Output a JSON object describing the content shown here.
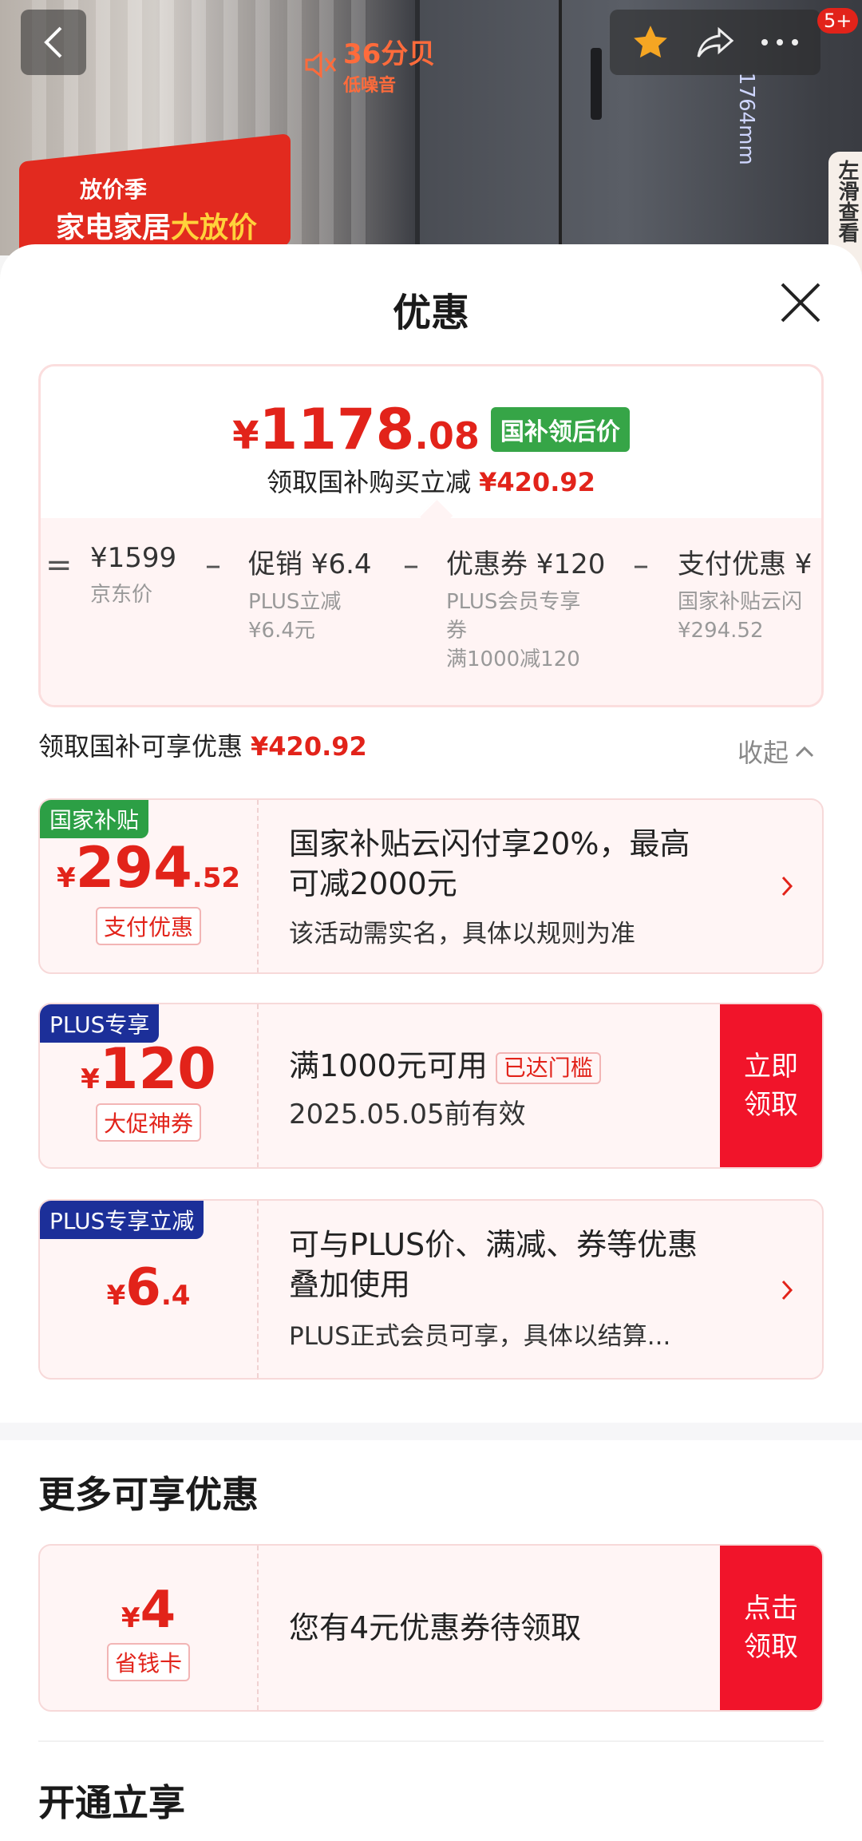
{
  "hero": {
    "promo_tag": "放价季",
    "promo_title_a": "家电家居",
    "promo_title_b": "大放价",
    "noise_value": "36分贝",
    "noise_label": "低噪音",
    "dimension": "1764mm",
    "side_hint": "左滑查看",
    "badge": "5+"
  },
  "sheet": {
    "title": "优惠"
  },
  "price_summary": {
    "yen": "¥",
    "price_int": "1178",
    "price_dec": ".08",
    "badge": "国补领后价",
    "sub_label": "领取国补购买立减",
    "sub_value": "¥420.92",
    "breakdown": [
      {
        "title": "¥1599",
        "lines": [
          "京东价"
        ]
      },
      {
        "title": "促销 ¥6.4",
        "lines": [
          "PLUS立减",
          "¥6.4元"
        ]
      },
      {
        "title": "优惠券 ¥120",
        "lines": [
          "PLUS会员专享",
          "券",
          "满1000减120"
        ]
      },
      {
        "title": "支付优惠 ¥",
        "lines": [
          "国家补贴云闪",
          "¥294.52"
        ]
      }
    ],
    "ops": [
      "=",
      "–",
      "–",
      "–"
    ]
  },
  "savings": {
    "label": "领取国补可享优惠",
    "value": "¥420.92",
    "collapse": "收起"
  },
  "coupons": [
    {
      "tag": "国家补贴",
      "yen": "¥",
      "int": "294",
      "dec": ".52",
      "label": "支付优惠",
      "main_1": "国家补贴云闪付享20%，最高",
      "main_2": "可减2000元",
      "sub": "该活动需实名，具体以规则为准"
    },
    {
      "tag": "PLUS专享",
      "yen": "¥",
      "int": "120",
      "label": "大促神券",
      "main": "满1000元可用",
      "reached": "已达门槛",
      "sub": "2025.05.05前有效",
      "action_1": "立即",
      "action_2": "领取"
    },
    {
      "tag": "PLUS专享立减",
      "yen": "¥",
      "int": "6",
      "dec": ".4",
      "main_1": "可与PLUS价、满减、券等优惠",
      "main_2": "叠加使用",
      "sub": "PLUS正式会员可享，具体以结算..."
    }
  ],
  "more": {
    "title": "更多可享优惠",
    "card": {
      "yen": "¥",
      "int": "4",
      "label": "省钱卡",
      "main": "您有4元优惠券待领取",
      "action_1": "点击",
      "action_2": "领取"
    }
  },
  "open_section": {
    "title": "开通立享"
  },
  "colors": {
    "accent_red": "#e2231a",
    "action_red": "#f1142a",
    "green_tag": "#2c9f45",
    "blue_tag": "#1c2f99"
  }
}
